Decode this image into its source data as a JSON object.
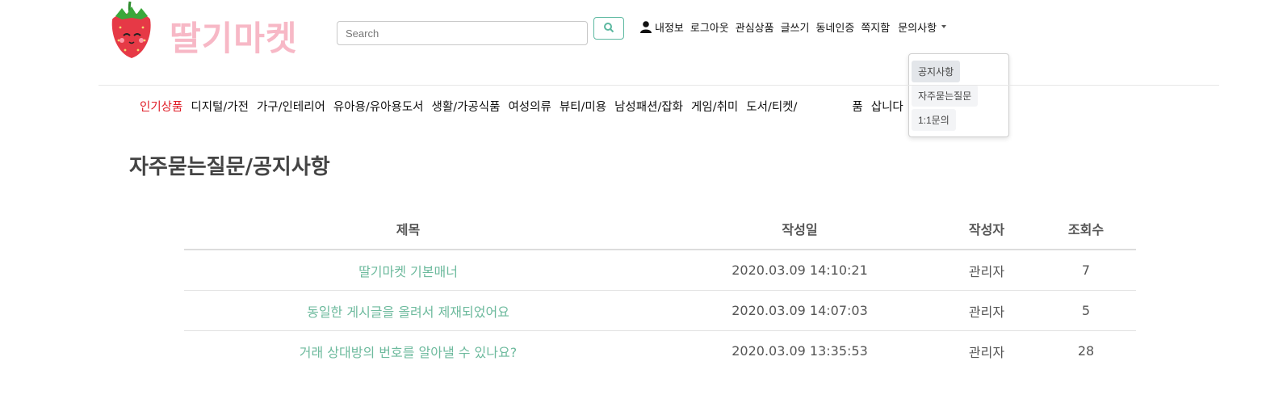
{
  "header": {
    "logo_text": "딸기마켓",
    "search": {
      "placeholder": "Search",
      "value": ""
    },
    "search_icon": "search-icon",
    "user_icon": "person-icon",
    "nav": [
      "내정보",
      "로그아웃",
      "관심상품",
      "글쓰기",
      "동네인증",
      "쪽지함"
    ],
    "inquiry_menu": {
      "label": "문의사항",
      "items": [
        "공지사항",
        "자주묻는질문",
        "1:1문의"
      ]
    }
  },
  "categories": [
    "인기상품",
    "디지털/가전",
    "가구/인테리어",
    "유아용/유아용도서",
    "생활/가공식품",
    "여성의류",
    "뷰티/미용",
    "남성패션/잡화",
    "게임/취미",
    "도서/티켓/",
    "품",
    "삽니다"
  ],
  "page_title": "자주묻는질문/공지사항",
  "board": {
    "headers": {
      "title": "제목",
      "date": "작성일",
      "author": "작성자",
      "views": "조회수"
    },
    "rows": [
      {
        "title": "딸기마켓 기본매너",
        "date": "2020.03.09 14:10:21",
        "author": "관리자",
        "views": "7"
      },
      {
        "title": "동일한 게시글을 올려서 제재되었어요",
        "date": "2020.03.09 14:07:03",
        "author": "관리자",
        "views": "5"
      },
      {
        "title": "거래 상대방의 번호를 알아낼 수 있나요?",
        "date": "2020.03.09 13:35:53",
        "author": "관리자",
        "views": "28"
      }
    ]
  },
  "colors": {
    "accent": "#6dba9d",
    "brand_pink": "#f7b8c6",
    "active_category": "#e0202a"
  }
}
